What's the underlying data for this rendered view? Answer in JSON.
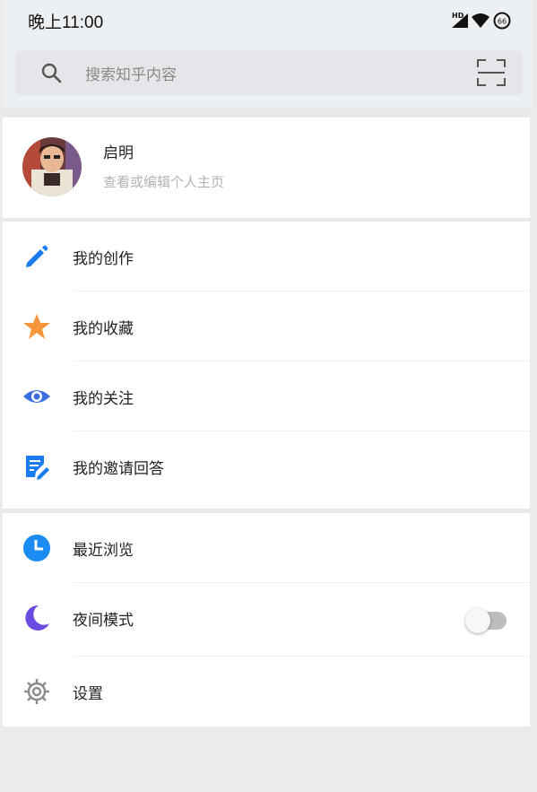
{
  "status_bar": {
    "time": "晚上11:00",
    "network_label": "HD",
    "battery_level": "66"
  },
  "search": {
    "placeholder": "搜索知乎内容"
  },
  "profile": {
    "name": "启明",
    "subtitle": "查看或编辑个人主页"
  },
  "menu_group_1": {
    "items": [
      {
        "label": "我的创作",
        "icon": "pencil-icon",
        "color": "#1a7cf2"
      },
      {
        "label": "我的收藏",
        "icon": "star-icon",
        "color": "#f7953b"
      },
      {
        "label": "我的关注",
        "icon": "eye-icon",
        "color": "#3b6fe0"
      },
      {
        "label": "我的邀请回答",
        "icon": "edit-note-icon",
        "color": "#1a7cf2"
      }
    ]
  },
  "menu_group_2": {
    "items": [
      {
        "label": "最近浏览",
        "icon": "clock-icon",
        "color": "#1a8cf2"
      },
      {
        "label": "夜间模式",
        "icon": "moon-icon",
        "color": "#6a4de0"
      },
      {
        "label": "设置",
        "icon": "gear-icon",
        "color": "#8c8c8c"
      }
    ]
  },
  "night_mode": {
    "enabled": false
  }
}
